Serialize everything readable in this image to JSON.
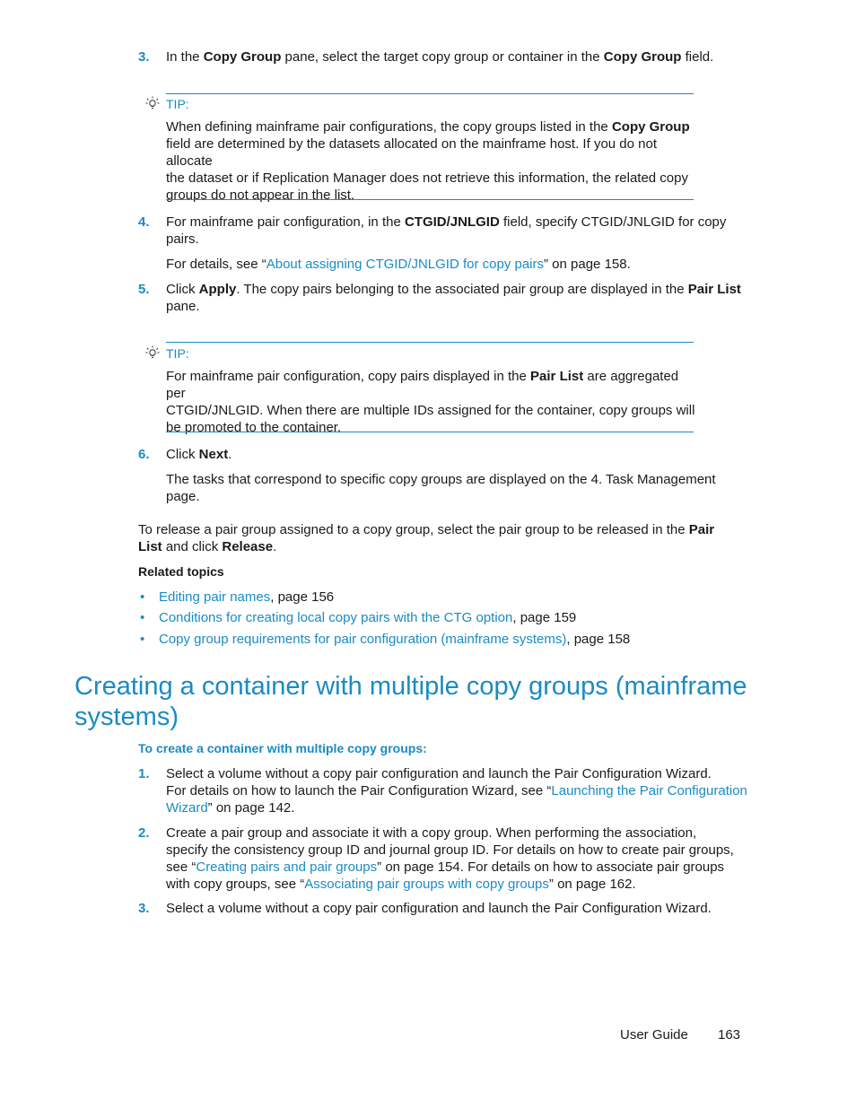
{
  "steps_top": [
    {
      "num": "3.",
      "parts": [
        "In the ",
        "Copy Group",
        " pane, select the target copy group or container in the ",
        "Copy Group",
        " field."
      ]
    },
    {
      "num": "4.",
      "line1_a": "For mainframe pair configuration, in the ",
      "line1_b": "CTGID/JNLGID",
      "line1_c": " field, specify CTGID/JNLGID for copy",
      "line2": "pairs.",
      "detail_pre": "For details, see “",
      "detail_link": "About assigning CTGID/JNLGID for copy pairs",
      "detail_post": "” on page 158."
    },
    {
      "num": "5.",
      "a": "Click ",
      "b": "Apply",
      "c": ". The copy pairs belonging to the associated pair group are displayed in the ",
      "d": "Pair List",
      "line2": "pane."
    },
    {
      "num": "6.",
      "a": "Click ",
      "b": "Next",
      "c": ".",
      "detail1": "The tasks that correspond to specific copy groups are displayed on the 4. Task Management",
      "detail2": "page."
    }
  ],
  "tip1": {
    "label": "TIP:",
    "line1_a": "When defining mainframe pair configurations, the copy groups listed in the ",
    "line1_b": "Copy Group",
    "line2": "field are determined by the datasets allocated on the mainframe host. If you do not allocate",
    "line3": "the dataset or if Replication Manager does not retrieve this information, the related copy",
    "line4": "groups do not appear in the list."
  },
  "tip2": {
    "label": "TIP:",
    "line1_a": "For mainframe pair configuration, copy pairs displayed in the ",
    "line1_b": "Pair List",
    "line1_c": " are aggregated per",
    "line2": "CTGID/JNLGID. When there are multiple IDs assigned for the container, copy groups will",
    "line3": "be promoted to the container."
  },
  "release": {
    "a": "To release a pair group assigned to a copy group, select the pair group to be released in the ",
    "b": "Pair",
    "c": "List",
    "d": " and click ",
    "e": "Release",
    "f": "."
  },
  "related": {
    "heading": "Related topics",
    "bullet": "•",
    "items": [
      {
        "link": "Editing pair names",
        "suffix": ", page 156"
      },
      {
        "link": "Conditions for creating local copy pairs with the CTG option",
        "suffix": ", page 159"
      },
      {
        "link": "Copy group requirements for pair configuration (mainframe systems)",
        "suffix": ", page 158"
      }
    ]
  },
  "section": {
    "title_line1": "Creating a container with multiple copy groups (mainframe",
    "title_line2": "systems)",
    "procedure": "To create a container with multiple copy groups:",
    "steps": [
      {
        "num": "1.",
        "line1": "Select a volume without a copy pair configuration and launch the Pair Configuration Wizard.",
        "line2_pre": "For details on how to launch the Pair Configuration Wizard, see “",
        "link_a": "Launching the Pair Configuration",
        "link_b": "Wizard",
        "line3_post": "” on page 142."
      },
      {
        "num": "2.",
        "line1": "Create a pair group and associate it with a copy group. When performing the association,",
        "line2": "specify the consistency group ID and journal group ID. For details on how to create pair groups,",
        "line3_pre": "see “",
        "line3_link": "Creating pairs and pair groups",
        "line3_post": "” on page 154. For details on how to associate pair groups",
        "line4_pre": "with copy groups, see “",
        "line4_link": "Associating pair groups with copy groups",
        "line4_post": "” on page 162."
      },
      {
        "num": "3.",
        "line1": "Select a volume without a copy pair configuration and launch the Pair Configuration Wizard."
      }
    ]
  },
  "footer": {
    "guide": "User Guide",
    "page": "163"
  },
  "colors": {
    "accent": "#1a8bc4",
    "text": "#1a1a1a"
  }
}
